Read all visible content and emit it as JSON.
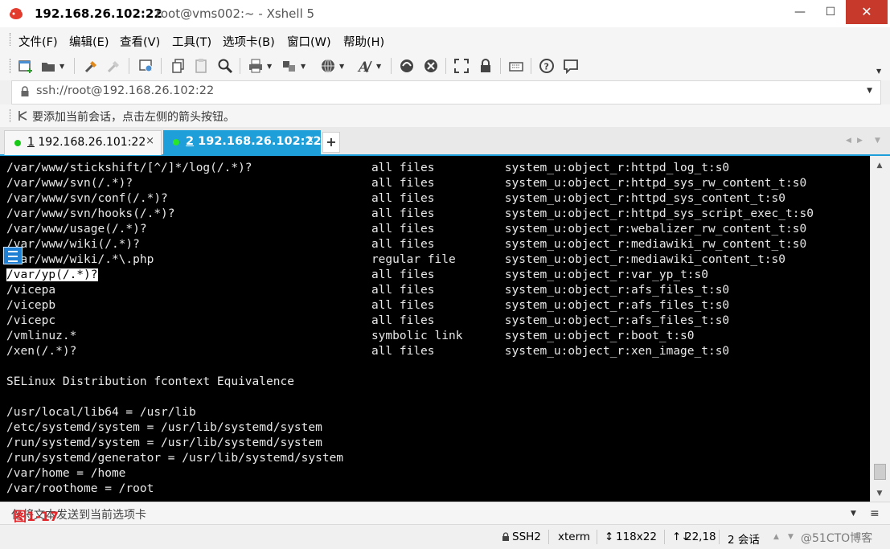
{
  "window": {
    "title_host": "192.168.26.102:22",
    "title_rest": "root@vms002:~ - Xshell 5",
    "minimize": "—",
    "maximize": "☐",
    "close": "✕"
  },
  "menu": [
    "文件(F)",
    "编辑(E)",
    "查看(V)",
    "工具(T)",
    "选项卡(B)",
    "窗口(W)",
    "帮助(H)"
  ],
  "toolbar_icons": [
    "new-session-icon",
    "open-folder-icon",
    "connect-icon",
    "disconnect-icon",
    "properties-icon",
    "copy-icon",
    "paste-icon",
    "find-icon",
    "print-icon",
    "transfer-icon",
    "globe-icon",
    "font-icon",
    "xftp-icon",
    "xmanager-icon",
    "fullscreen-icon",
    "lock-icon",
    "keyboard-icon",
    "help-icon",
    "chat-icon"
  ],
  "address": {
    "value": "ssh://root@192.168.26.102:22"
  },
  "hint": {
    "text": "要添加当前会话，点击左侧的箭头按钮。"
  },
  "tabs": [
    {
      "num": "1",
      "label": "192.168.26.101:22",
      "close": "×"
    },
    {
      "num": "2",
      "label": "192.168.26.102:22",
      "close": "×"
    }
  ],
  "tab_add": "+",
  "terminal": {
    "lines": [
      "/var/www/stickshift/[^/]*/log(/.*)?                 all files          system_u:object_r:httpd_log_t:s0",
      "/var/www/svn(/.*)?                                  all files          system_u:object_r:httpd_sys_rw_content_t:s0",
      "/var/www/svn/conf(/.*)?                             all files          system_u:object_r:httpd_sys_content_t:s0",
      "/var/www/svn/hooks(/.*)?                            all files          system_u:object_r:httpd_sys_script_exec_t:s0",
      "/var/www/usage(/.*)?                                all files          system_u:object_r:webalizer_rw_content_t:s0",
      "/var/www/wiki(/.*)?                                 all files          system_u:object_r:mediawiki_rw_content_t:s0",
      "/var/www/wiki/.*\\.php                               regular file       system_u:object_r:mediawiki_content_t:s0",
      "/var/yp(/.*)?                                       all files          system_u:object_r:var_yp_t:s0",
      "/vicepa                                             all files          system_u:object_r:afs_files_t:s0",
      "/vicepb                                             all files          system_u:object_r:afs_files_t:s0",
      "/vicepc                                             all files          system_u:object_r:afs_files_t:s0",
      "/vmlinuz.*                                          symbolic link      system_u:object_r:boot_t:s0",
      "/xen(/.*)?                                          all files          system_u:object_r:xen_image_t:s0",
      "",
      "SELinux Distribution fcontext Equivalence",
      "",
      "/usr/local/lib64 = /usr/lib",
      "/etc/systemd/system = /usr/lib/systemd/system",
      "/run/systemd/system = /usr/lib/systemd/system",
      "/run/systemd/generator = /usr/lib/systemd/system",
      "/var/home = /home",
      "/var/roothome = /root"
    ],
    "highlight_text": "/var/yp(/.*)?",
    "highlight_line_index": 7
  },
  "compose": {
    "text": "仅将文本发送到当前选项卡",
    "figure_label": "图1-17",
    "menu_glyph": "≡"
  },
  "status": {
    "protocol": "SSH2",
    "terminal_type": "xterm",
    "size": "118x22",
    "cursor": "22,18",
    "sessions": "2 会话",
    "watermark": "@51CTO博客"
  },
  "colors": {
    "tab_active": "#1e9fd9",
    "terminal_bg": "#000000",
    "close_button": "#c7392b",
    "figure_label": "#e3262a"
  }
}
